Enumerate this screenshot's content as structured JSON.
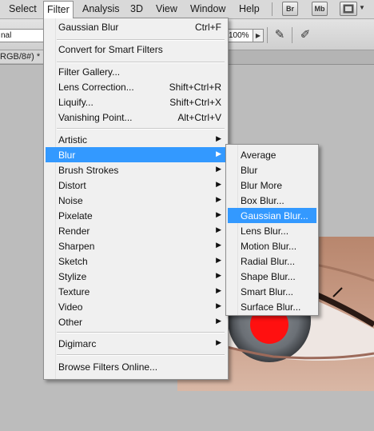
{
  "menubar": {
    "items": [
      "Select",
      "Filter",
      "Analysis",
      "3D",
      "View",
      "Window",
      "Help"
    ],
    "buttons": [
      "Br",
      "Mb"
    ]
  },
  "options": {
    "mode_value": "nal",
    "zoom_value": "100%"
  },
  "doc_tab": {
    "title": "RGB/8#) *"
  },
  "filter_menu": {
    "last_filter": {
      "label": "Gaussian Blur",
      "shortcut": "Ctrl+F"
    },
    "convert": "Convert for Smart Filters",
    "gallery_group": [
      {
        "label": "Filter Gallery...",
        "shortcut": ""
      },
      {
        "label": "Lens Correction...",
        "shortcut": "Shift+Ctrl+R"
      },
      {
        "label": "Liquify...",
        "shortcut": "Shift+Ctrl+X"
      },
      {
        "label": "Vanishing Point...",
        "shortcut": "Alt+Ctrl+V"
      }
    ],
    "categories": [
      "Artistic",
      "Blur",
      "Brush Strokes",
      "Distort",
      "Noise",
      "Pixelate",
      "Render",
      "Sharpen",
      "Sketch",
      "Stylize",
      "Texture",
      "Video",
      "Other"
    ],
    "digimarc": "Digimarc",
    "browse": "Browse Filters Online..."
  },
  "blur_submenu": {
    "items": [
      "Average",
      "Blur",
      "Blur More",
      "Box Blur...",
      "Gaussian Blur...",
      "Lens Blur...",
      "Motion Blur...",
      "Radial Blur...",
      "Shape Blur...",
      "Smart Blur...",
      "Surface Blur..."
    ],
    "highlighted": "Gaussian Blur..."
  },
  "colors": {
    "highlight": "#3399ff",
    "menu_bg": "#f0f0f0",
    "canvas_bg": "#bcbcbc",
    "pupil_red": "#ff1010"
  }
}
